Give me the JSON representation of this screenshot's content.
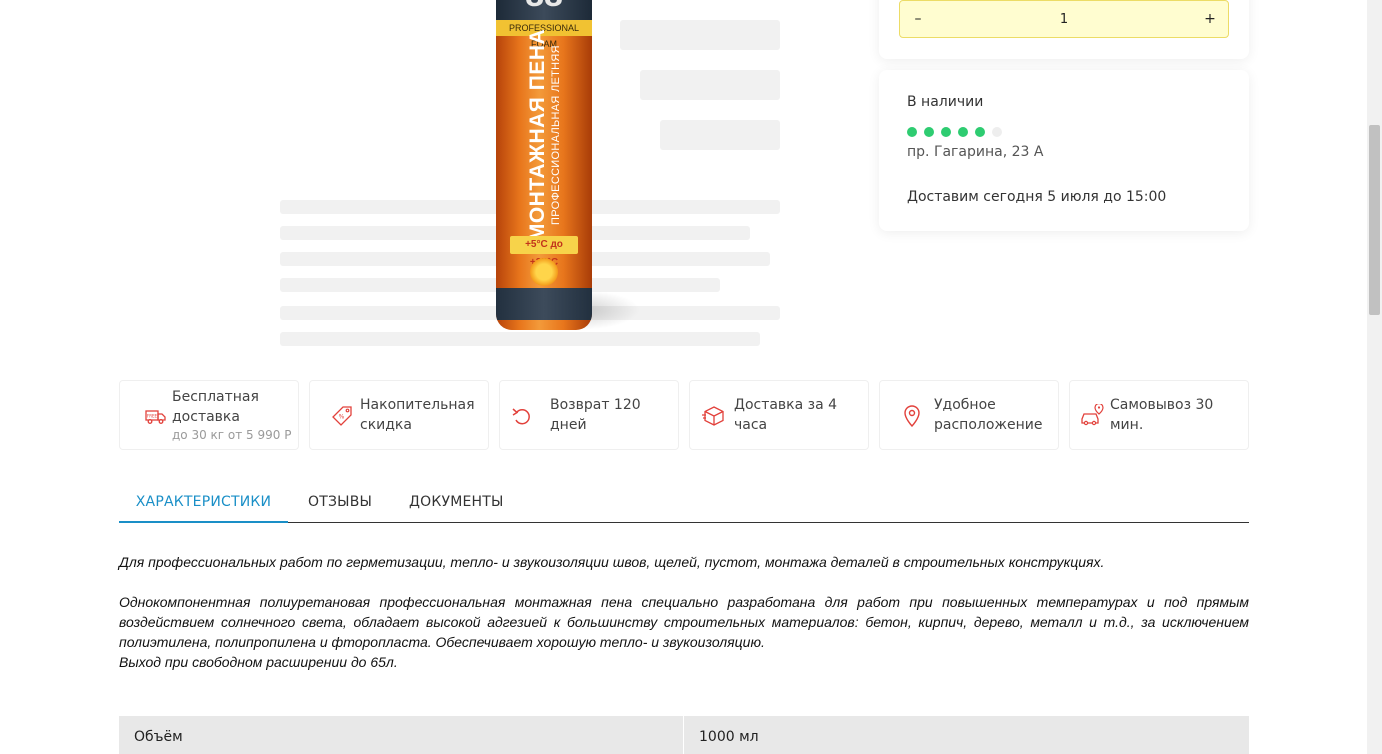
{
  "product": {
    "can_number": "88",
    "can_band": "PROFESSIONAL FOAM",
    "can_title": "МОНТАЖНАЯ ПЕНА",
    "can_subtitle": "ПРОФЕССИОНАЛЬНАЯ ЛЕТНЯЯ",
    "can_temp": "+5°C до +35°C"
  },
  "quantity": {
    "minus": "–",
    "value": "1",
    "plus": "+"
  },
  "stock": {
    "status": "В наличии",
    "level_filled": 5,
    "level_total": 6,
    "dot_color_filled": "#2ecc71",
    "dot_color_empty": "#eeeeee",
    "address": "пр. Гагарина, 23 А",
    "delivery": "Доставим сегодня 5 июля до 15:00"
  },
  "benefits": [
    {
      "icon": "truck-icon",
      "title": "Бесплатная доставка",
      "sub": "до 30 кг от 5 990 Р"
    },
    {
      "icon": "discount-tag-icon",
      "title": "Накопительная скидка"
    },
    {
      "icon": "return-arrow-icon",
      "title": "Возврат 120 дней"
    },
    {
      "icon": "box-icon",
      "title": "Доставка за 4 часа"
    },
    {
      "icon": "location-pin-icon",
      "title": "Удобное расположение"
    },
    {
      "icon": "car-pin-icon",
      "title": "Самовывоз 30 мин."
    }
  ],
  "tabs": [
    {
      "label": "ХАРАКТЕРИСТИКИ",
      "active": true
    },
    {
      "label": "ОТЗЫВЫ",
      "active": false
    },
    {
      "label": "ДОКУМЕНТЫ",
      "active": false
    }
  ],
  "description": {
    "p1": "Для профессиональных работ по герметизации, тепло- и звукоизоляции швов, щелей, пустот, монтажа деталей в строительных конструкциях.",
    "p2": "Однокомпонентная полиуретановая профессиональная монтажная пена специально разработана для работ при повышенных температурах и под прямым воздействием солнечного света, обладает высокой адгезией к большинству строительных материалов: бетон, кирпич, дерево, металл и т.д., за исключением полиэтилена, полипропилена и фторопласта. Обеспечивает хорошую тепло- и звукоизоляцию.",
    "p3": "Выход при свободном расширении до 65л."
  },
  "specs": [
    {
      "name": "Объём",
      "value": "1000 мл"
    }
  ],
  "colors": {
    "accent": "#1a8fc7",
    "icon_red": "#e2413b",
    "stepper_bg": "#fffdd0"
  }
}
